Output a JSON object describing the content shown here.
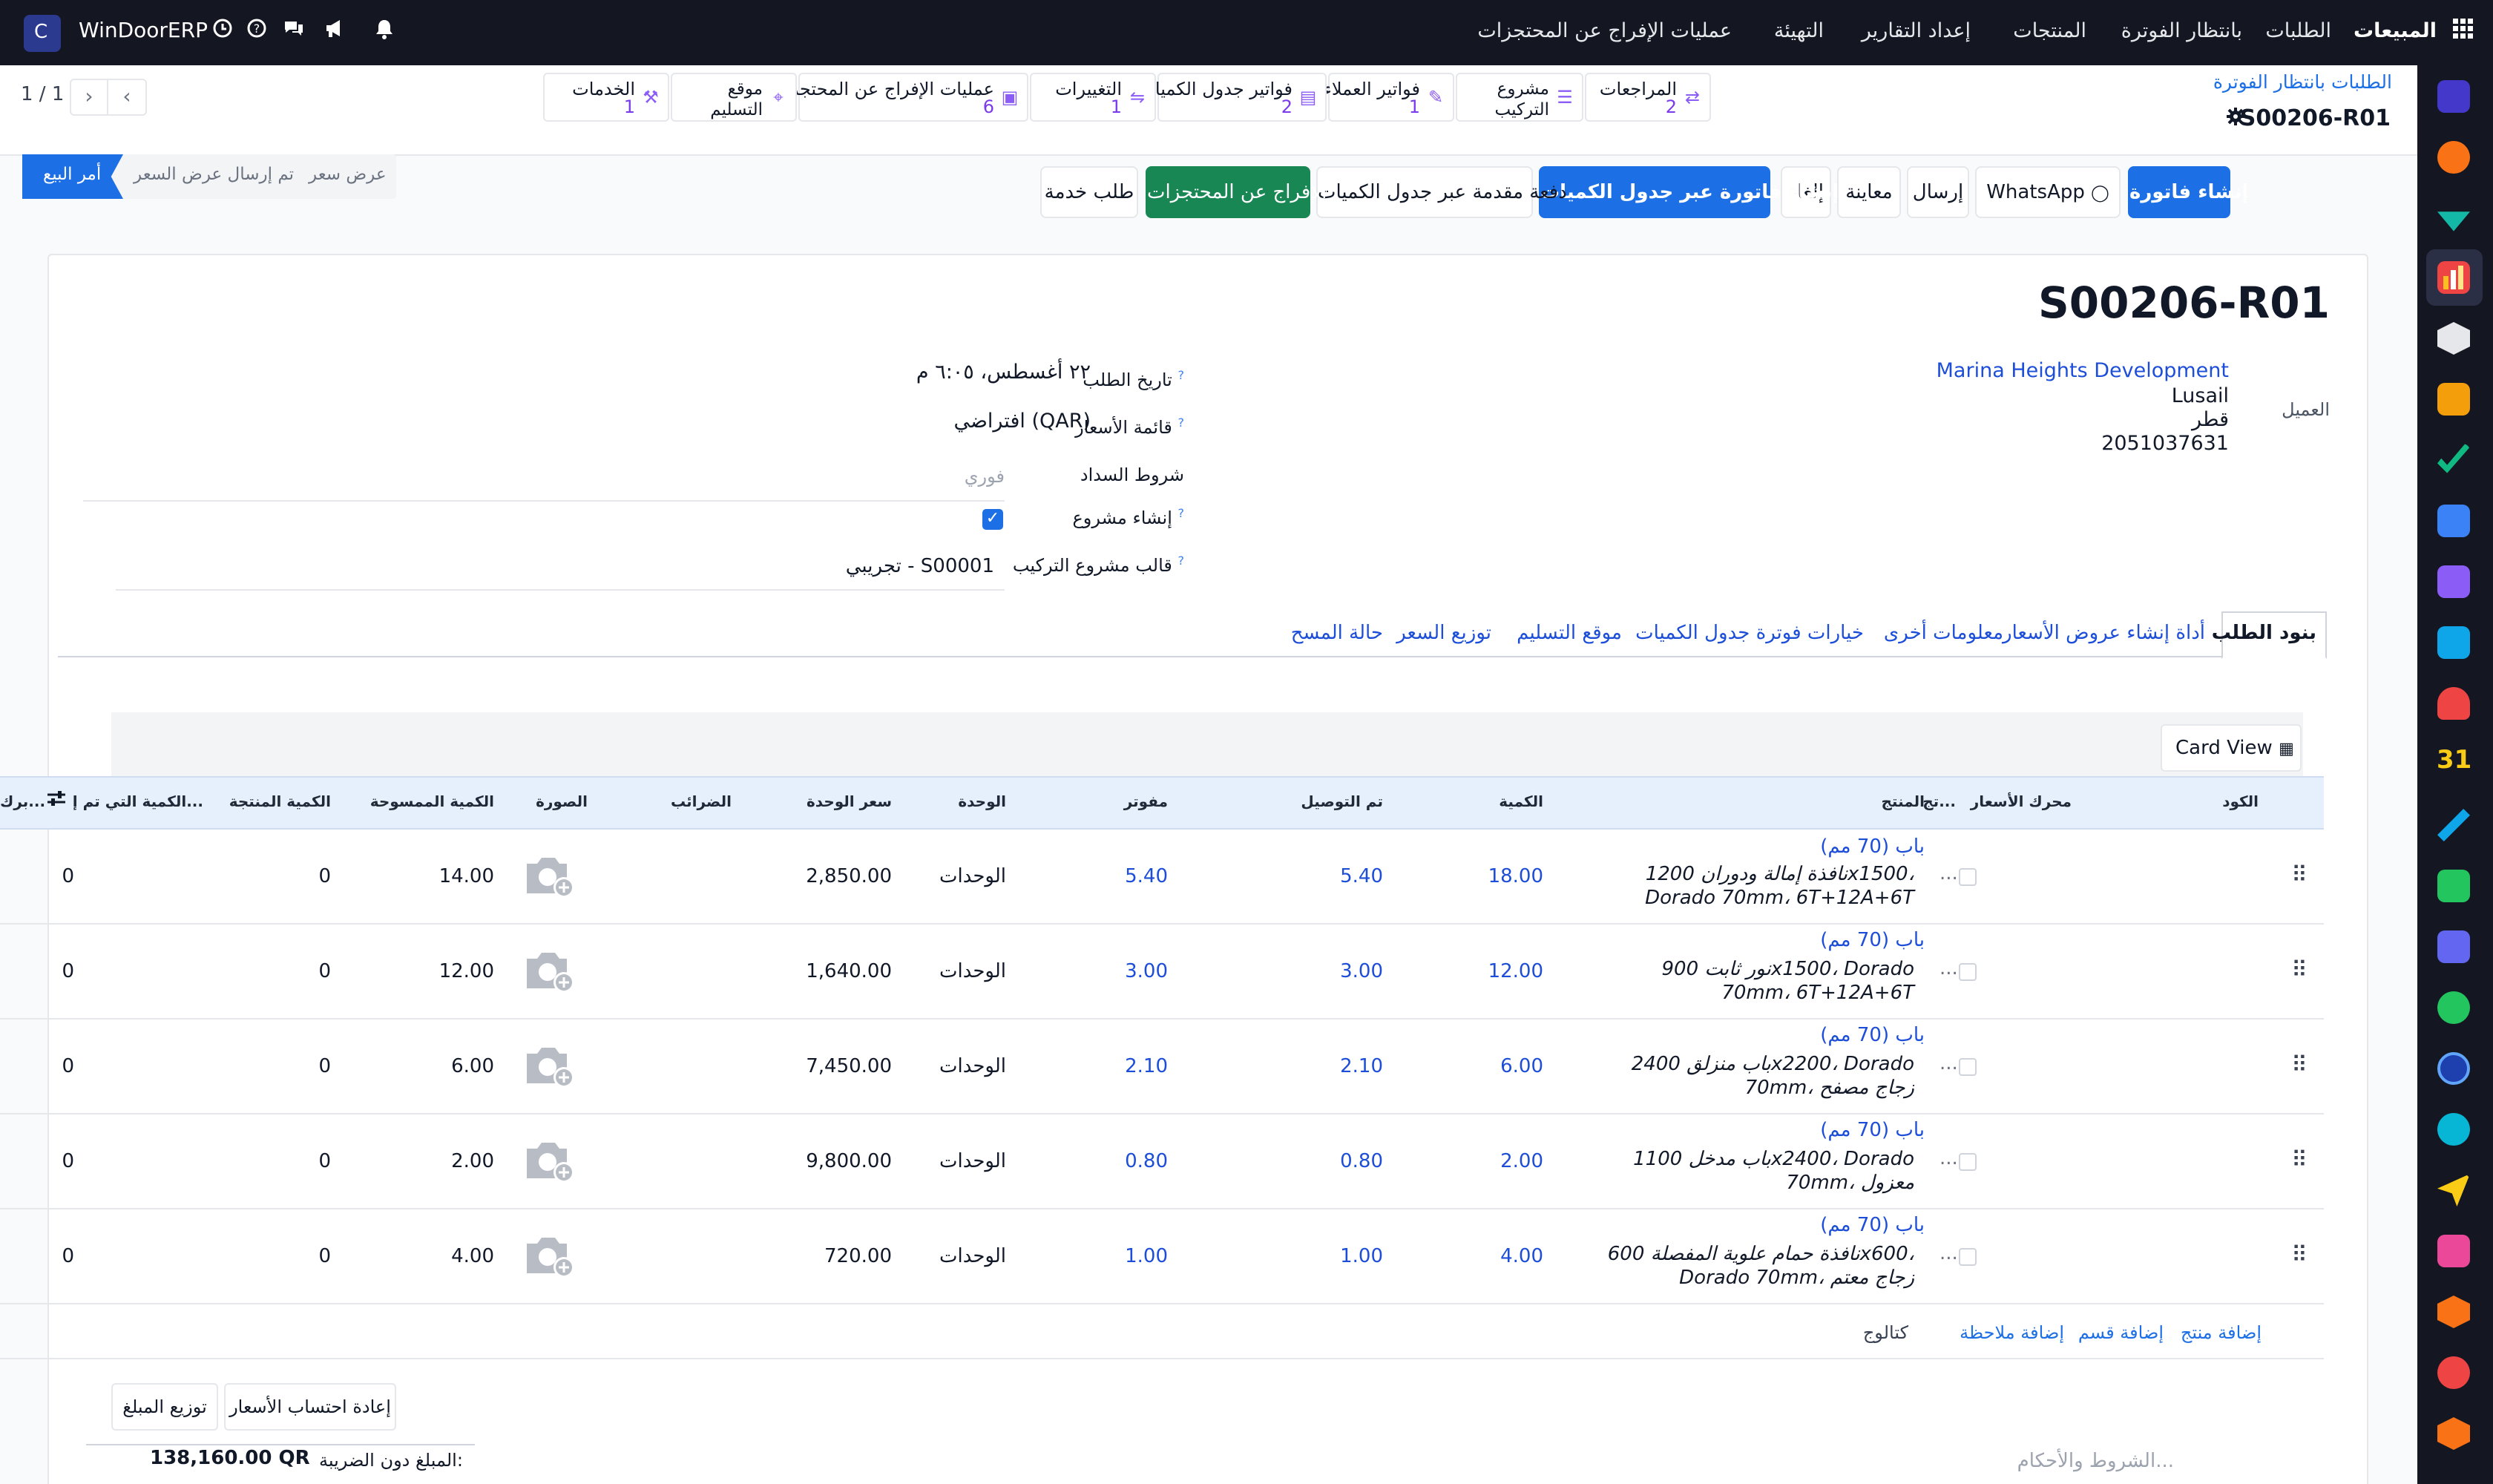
{
  "topnav": {
    "apps_label": "المبيعات",
    "menu": [
      "الطلبات",
      "بانتظار الفوترة",
      "المنتجات",
      "إعداد التقارير",
      "التهيئة",
      "عمليات الإفراج عن المحتجزات"
    ],
    "company": "WinDoorERP",
    "company_initial": "C"
  },
  "breadcrumb": {
    "parent": "الطلبات بانتظار الفوترة",
    "current": "S00206-R01",
    "pager": "1 / 1"
  },
  "stat_buttons": [
    {
      "label": "المراجعات",
      "count": "2"
    },
    {
      "label": "مشروع التركيب",
      "count": ""
    },
    {
      "label": "فواتير العملاء",
      "count": "1"
    },
    {
      "label": "فواتير جدول الكميات",
      "count": "2"
    },
    {
      "label": "التغييرات",
      "count": "1"
    },
    {
      "label": "عمليات الإفراج عن المحتجزات",
      "count": "6"
    },
    {
      "label": "موقع التسليم",
      "count": ""
    },
    {
      "label": "الخدمات",
      "count": "1"
    }
  ],
  "actions": {
    "create_invoice": "إنشاء فاتورة",
    "whatsapp": "WhatsApp",
    "send": "إرسال",
    "preview": "معاينة",
    "cancel": "إلغاء",
    "boq_invoice": "إنشاء فاتورة عبر جدول الكميات",
    "boq_down_payment": "دفعة مقدمة عبر جدول الكميات",
    "release_retention": "الإفراج عن المحتجزات",
    "service_request": "طلب خدمة"
  },
  "status_bar": [
    "عرض سعر",
    "تم إرسال عرض السعر",
    "أمر البيع"
  ],
  "form": {
    "title": "S00206-R01",
    "customer_label": "العميل",
    "customer_name": "Marina Heights Development",
    "customer_city": "Lusail",
    "customer_country": "قطر",
    "customer_phone": "2051037631",
    "order_date_label": "تاريخ الطلب",
    "order_date": "٢٢ أغسطس، ٦:٠٥ م",
    "pricelist_label": "قائمة الأسعار",
    "pricelist": "افتراضي (QAR)",
    "payment_terms_label": "شروط السداد",
    "payment_terms_placeholder": "فوري",
    "create_project_label": "إنشاء مشروع",
    "create_project_checked": true,
    "template_label": "قالب مشروع التركيب",
    "template": "تجريبي - S00001"
  },
  "tabs": [
    "بنود الطلب",
    "أداة إنشاء عروض الأسعار",
    "معلومات أخرى",
    "خيارات فوترة جدول الكميات",
    "موقع التسليم",
    "توزيع السعر",
    "حالة المسح"
  ],
  "card_view_label": "Card View",
  "table": {
    "headers": {
      "code": "الكود",
      "price_engine": "محرك الأسعار",
      "tj": "تج...",
      "product": "المنتج",
      "qty": "الكمية",
      "delivered": "تم التوصيل",
      "invoiced": "مفوتر",
      "unit": "الوحدة",
      "unit_price": "سعر الوحدة",
      "taxes": "الضرائب",
      "image": "الصورة",
      "surveyed_qty": "الكمية الممسوحة",
      "produced_qty": "الكمية المنتجة",
      "remaining_qty": "الكمية التي تم إ...",
      "extra": "برك..."
    },
    "rows": [
      {
        "title": "باب (70 مم)",
        "desc": "نافذة إمالة ودوران 1200x1500، Dorado 70mm، 6T+12A+6T",
        "qty": "18.00",
        "delivered": "5.40",
        "invoiced": "5.40",
        "unit": "الوحدات",
        "price": "2,850.00",
        "surveyed": "14.00",
        "produced": "0",
        "remaining": "0"
      },
      {
        "title": "باب (70 مم)",
        "desc": "نور ثابت 900x1500، Dorado 70mm، 6T+12A+6T",
        "qty": "12.00",
        "delivered": "3.00",
        "invoiced": "3.00",
        "unit": "الوحدات",
        "price": "1,640.00",
        "surveyed": "12.00",
        "produced": "0",
        "remaining": "0"
      },
      {
        "title": "باب (70 مم)",
        "desc": "باب منزلق 2400x2200، Dorado 70mm، زجاج مصفح",
        "qty": "6.00",
        "delivered": "2.10",
        "invoiced": "2.10",
        "unit": "الوحدات",
        "price": "7,450.00",
        "surveyed": "6.00",
        "produced": "0",
        "remaining": "0"
      },
      {
        "title": "باب (70 مم)",
        "desc": "باب مدخل 1100x2400، Dorado 70mm، معزول",
        "qty": "2.00",
        "delivered": "0.80",
        "invoiced": "0.80",
        "unit": "الوحدات",
        "price": "9,800.00",
        "surveyed": "2.00",
        "produced": "0",
        "remaining": "0"
      },
      {
        "title": "باب (70 مم)",
        "desc": "نافذة حمام علوية المفصلة 600x600، Dorado 70mm، زجاج معتم",
        "qty": "4.00",
        "delivered": "1.00",
        "invoiced": "1.00",
        "unit": "الوحدات",
        "price": "720.00",
        "surveyed": "4.00",
        "produced": "0",
        "remaining": "0"
      }
    ],
    "add_links": {
      "add_product": "إضافة منتج",
      "add_section": "إضافة قسم",
      "add_note": "إضافة ملاحظة",
      "catalog": "كتالوج"
    }
  },
  "footer": {
    "recompute": "إعادة احتساب الأسعار",
    "distribute": "توزيع المبلغ",
    "untaxed_label": "المبلغ دون الضريبة:",
    "untaxed_value": "138,160.00 QR",
    "terms_placeholder": "الشروط والأحكام..."
  },
  "colors": {
    "primary": "#1d6fe5",
    "nav_bg": "#141622",
    "success": "#198754",
    "accent": "#7c3aed"
  }
}
